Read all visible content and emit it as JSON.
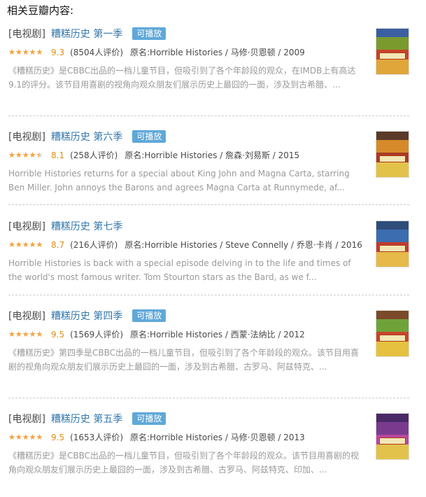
{
  "section": {
    "heading": "相关豆瓣内容:"
  },
  "items": [
    {
      "category": "[电视剧]",
      "title": "糟糕历史 第一季",
      "badge": "可播放",
      "stars_fraction": 0.9,
      "score": "9.3",
      "votes": "(8504人评价)",
      "original": "原名:Horrible Histories / 马修·贝恩顿 / 2009",
      "description": "《糟糕历史》是CBBC出品的一档儿童节目，但吸引到了各个年龄段的观众，在IMDB上有高达9.1的评分。该节目用喜剧的视角向观众朋友们展示历史上最囧的一面，涉及到古希腊、...",
      "poster_icon": "tv-poster-thumbnail",
      "poster_colors": [
        "#7a9a2e",
        "#c9432b",
        "#e0a63a",
        "#3b5fa0"
      ]
    },
    {
      "category": "[电视剧]",
      "title": "糟糕历史 第六季",
      "badge": "可播放",
      "stars_fraction": 0.8,
      "score": "8.1",
      "votes": "(258人评价)",
      "original": "原名:Horrible Histories / 詹森·刘易斯 / 2015",
      "description": "Horrible Histories returns for a special about King John and Magna Carta, starring Ben Miller. John annoys the Barons and agrees Magna Carta at Runnymede, af...",
      "poster_icon": "tv-poster-thumbnail",
      "poster_colors": [
        "#d78a2a",
        "#a93a22",
        "#e3c24a",
        "#5a3b2a"
      ]
    },
    {
      "category": "[电视剧]",
      "title": "糟糕历史 第七季",
      "badge": "",
      "stars_fraction": 0.9,
      "score": "8.7",
      "votes": "(216人评价)",
      "original": "原名:Horrible Histories / Steve Connelly / 乔恩·卡肖 / 2016",
      "description": "Horrible Histories is back with a special episode delving in to the life and times of the world's most famous writer. Tom Stourton stars as the Bard, as we f...",
      "poster_icon": "tv-poster-thumbnail",
      "poster_colors": [
        "#3c6db0",
        "#c23b2d",
        "#e6b948",
        "#2f4d7a"
      ]
    },
    {
      "category": "[电视剧]",
      "title": "糟糕历史 第四季",
      "badge": "可播放",
      "stars_fraction": 1.0,
      "score": "9.5",
      "votes": "(1569人评价)",
      "original": "原名:Horrible Histories / 西蒙·法纳比 / 2012",
      "description": "《糟糕历史》第四季是CBBC出品的一档儿童节目，但吸引到了各个年龄段的观众。该节目用喜剧的视角向观众朋友们展示历史上最囧的一面，涉及到古希腊、古罗马、阿兹特克、...",
      "poster_icon": "tv-poster-thumbnail",
      "poster_colors": [
        "#6fa33a",
        "#c8432d",
        "#e5c13f",
        "#7a4a2a"
      ]
    },
    {
      "category": "[电视剧]",
      "title": "糟糕历史 第五季",
      "badge": "可播放",
      "stars_fraction": 1.0,
      "score": "9.5",
      "votes": "(1653人评价)",
      "original": "原名:Horrible Histories / 马修·贝恩顿 / 2013",
      "description": "《糟糕历史》是CBBC出品的一档儿童节目，但吸引到了各个年龄段的观众。该节目用喜剧的视角向观众朋友们展示历史上最囧的一面，涉及到古希腊、古罗马、阿兹特克、印加、...",
      "poster_icon": "tv-poster-thumbnail",
      "poster_colors": [
        "#7a3b8f",
        "#b8489e",
        "#e2c24a",
        "#4a2a66"
      ]
    }
  ]
}
